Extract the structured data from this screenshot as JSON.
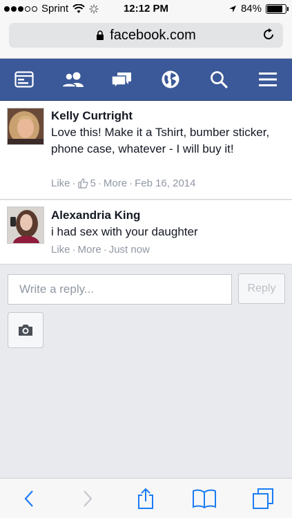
{
  "status_bar": {
    "carrier": "Sprint",
    "time": "12:12 PM",
    "battery": "84%",
    "battery_level": 0.84
  },
  "browser": {
    "url": "facebook.com"
  },
  "fb_nav": {
    "items": [
      "feed-icon",
      "friends-icon",
      "messages-icon",
      "notifications-globe-icon",
      "search-icon",
      "menu-icon"
    ]
  },
  "comments": [
    {
      "name": "Kelly Curtright",
      "text": "Love this! Make it a Tshirt, bumber sticker, phone case, whatever - I will buy it!",
      "like": "Like",
      "likes_count": "5",
      "more": "More",
      "time": "Feb 16, 2014"
    },
    {
      "name": "Alexandria King",
      "text": "i had sex with your daughter",
      "like": "Like",
      "more": "More",
      "time": "Just now"
    }
  ],
  "reply": {
    "placeholder": "Write a reply...",
    "button": "Reply"
  },
  "colors": {
    "facebook_blue": "#3b5998",
    "ios_blue": "#1a7cf5"
  }
}
